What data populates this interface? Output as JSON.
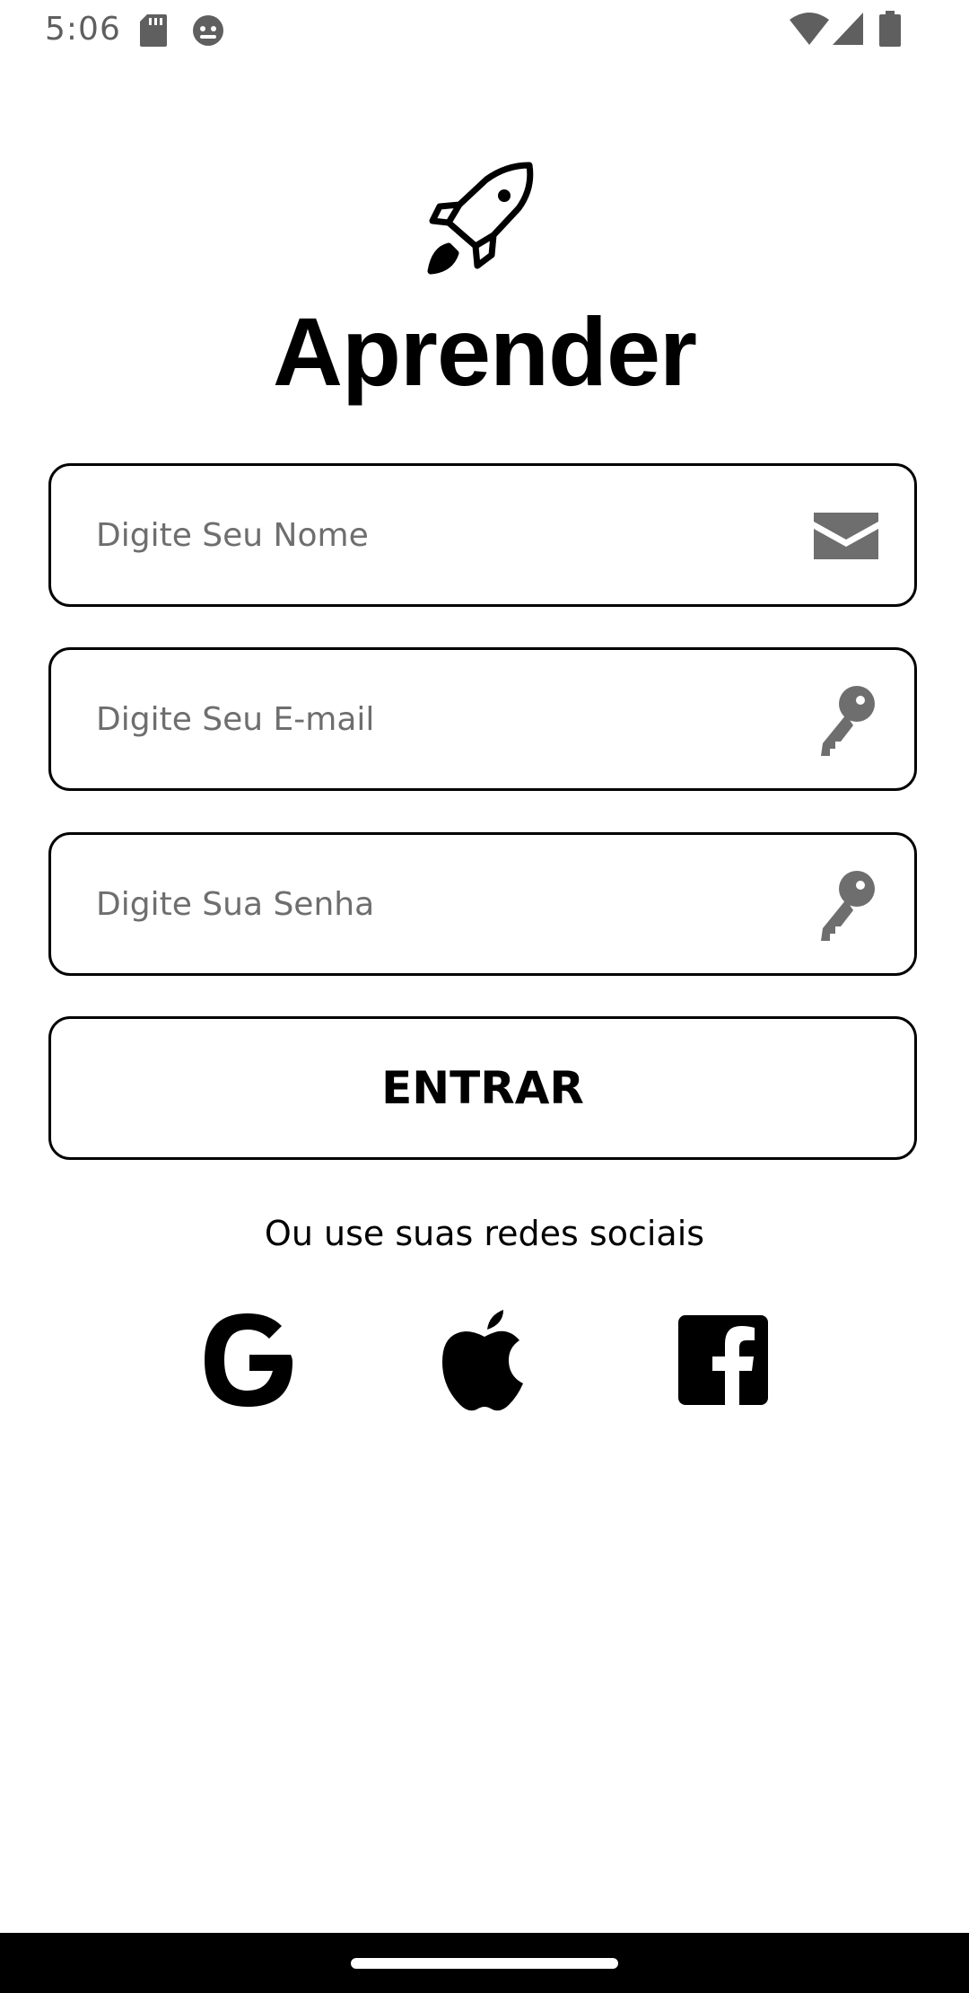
{
  "status_bar": {
    "time": "5:06",
    "icons": [
      "sd-card-icon",
      "android-debug-icon",
      "wifi-icon",
      "signal-icon",
      "battery-icon"
    ]
  },
  "app": {
    "logo_icon": "rocket-icon",
    "title": "Aprender"
  },
  "form": {
    "name_placeholder": "Digite Seu Nome",
    "name_icon": "envelope-icon",
    "email_placeholder": "Digite Seu E-mail",
    "email_icon": "key-icon",
    "password_placeholder": "Digite Sua Senha",
    "password_icon": "key-icon",
    "submit_label": "ENTRAR"
  },
  "social": {
    "prompt": "Ou use suas redes sociais",
    "providers": [
      "google-icon",
      "apple-icon",
      "facebook-icon"
    ]
  },
  "colors": {
    "background": "#ffffff",
    "text": "#000000",
    "placeholder": "#6e6e6e",
    "icon_gray": "#6e6e6e",
    "nav_bar": "#000000"
  }
}
